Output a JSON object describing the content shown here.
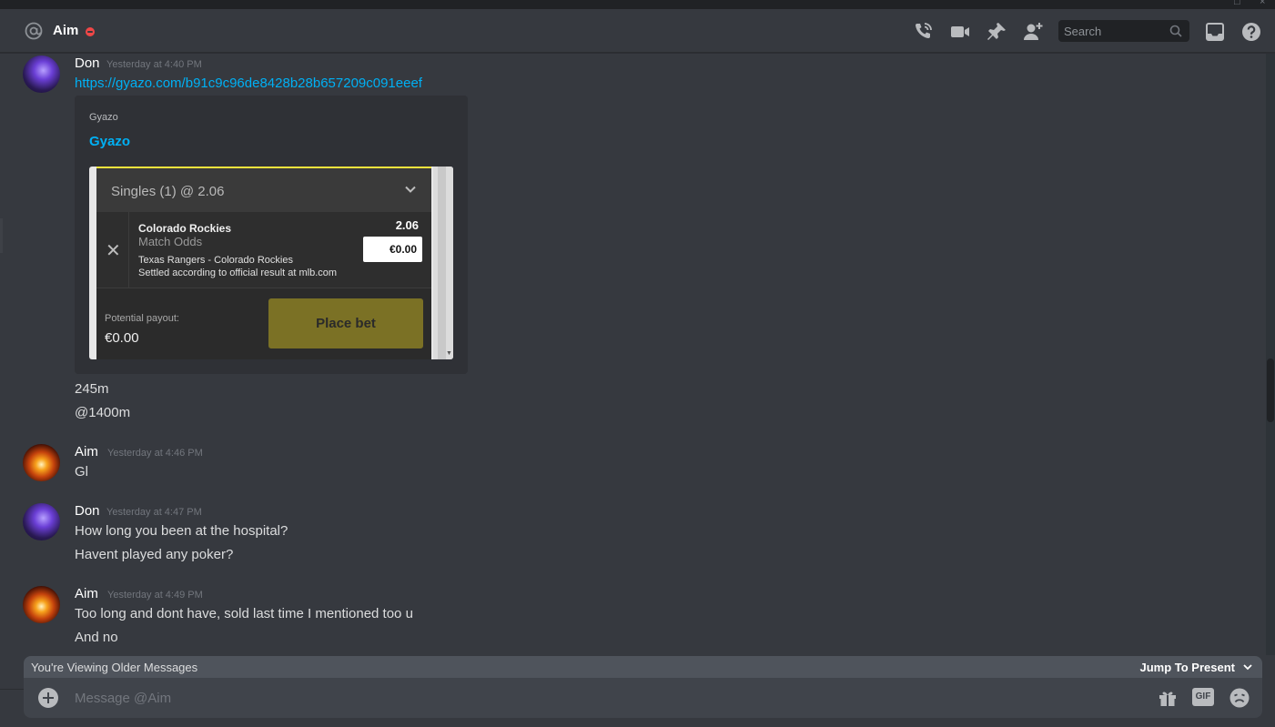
{
  "header": {
    "title": "Aim",
    "search_placeholder": "Search"
  },
  "icons": {
    "at": "at-icon",
    "dnd": "do-not-disturb-status-icon",
    "call": "phone-call-icon",
    "video": "video-call-icon",
    "pin": "pin-icon",
    "add_friend": "add-friend-icon",
    "search": "search-icon",
    "inbox": "inbox-icon",
    "help": "help-icon"
  },
  "messages": [
    {
      "author": "Don",
      "timestamp": "Yesterday at 4:40 PM",
      "lines": [
        "https://gyazo.com/b91c9c96de8428b28b657209c091eeef",
        "245m",
        "@1400m"
      ],
      "embed": {
        "provider": "Gyazo",
        "title": "Gyazo",
        "betslip": {
          "heading": "Singles (1) @ 2.06",
          "selection": "Colorado Rockies",
          "market": "Match Odds",
          "odds": "2.06",
          "stake": "€0.00",
          "event": "Texas Rangers - Colorado Rockies",
          "settled": "Settled according to official result at mlb.com",
          "payout_label": "Potential payout:",
          "payout_value": "€0.00",
          "button": "Place bet"
        }
      }
    },
    {
      "author": "Aim",
      "timestamp": "Yesterday at 4:46 PM",
      "lines": [
        "Gl"
      ]
    },
    {
      "author": "Don",
      "timestamp": "Yesterday at 4:47 PM",
      "lines": [
        "How long you been at the hospital?",
        "Havent played any poker?"
      ]
    },
    {
      "author": "Aim",
      "timestamp": "Yesterday at 4:49 PM",
      "lines": [
        "Too long and dont have, sold last time I mentioned too u",
        "And no"
      ]
    }
  ],
  "older_bar": {
    "label": "You're Viewing Older Messages",
    "jump": "Jump To Present"
  },
  "composer": {
    "placeholder": "Message @Aim",
    "gif_label": "GIF"
  },
  "colors": {
    "background": "#36393f",
    "link": "#00b0f4",
    "dnd": "#f04747",
    "place_bet": "#7b7125"
  }
}
